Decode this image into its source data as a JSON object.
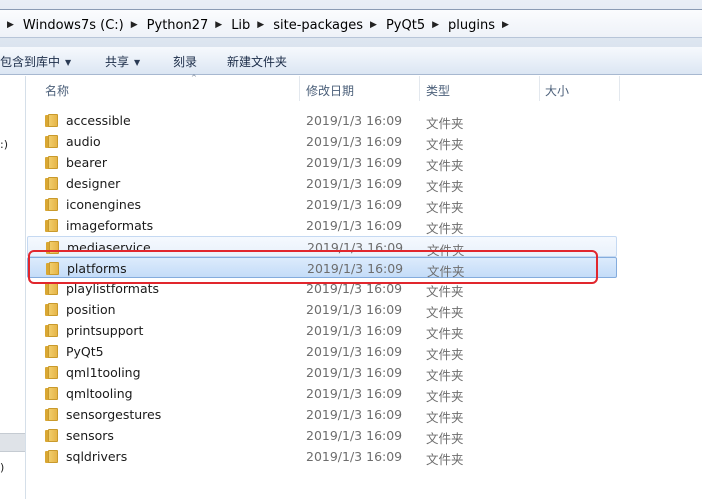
{
  "address": {
    "crumbs": [
      "Windows7s (C:)",
      "Python27",
      "Lib",
      "site-packages",
      "PyQt5",
      "plugins"
    ],
    "separator": "▶"
  },
  "toolbar": {
    "include_library": "包含到库中",
    "share": "共享",
    "burn": "刻录",
    "new_folder": "新建文件夹",
    "dropdown_arrow": "▼"
  },
  "navpane": {
    "frag1": ":)",
    "frag2": ")"
  },
  "columns": {
    "name": "名称",
    "date": "修改日期",
    "type": "类型",
    "size": "大小",
    "sort_indicator": "^"
  },
  "files": [
    {
      "name": "accessible",
      "date": "2019/1/3 16:09",
      "type": "文件夹"
    },
    {
      "name": "audio",
      "date": "2019/1/3 16:09",
      "type": "文件夹"
    },
    {
      "name": "bearer",
      "date": "2019/1/3 16:09",
      "type": "文件夹"
    },
    {
      "name": "designer",
      "date": "2019/1/3 16:09",
      "type": "文件夹"
    },
    {
      "name": "iconengines",
      "date": "2019/1/3 16:09",
      "type": "文件夹"
    },
    {
      "name": "imageformats",
      "date": "2019/1/3 16:09",
      "type": "文件夹"
    },
    {
      "name": "mediaservice",
      "date": "2019/1/3 16:09",
      "type": "文件夹"
    },
    {
      "name": "platforms",
      "date": "2019/1/3 16:09",
      "type": "文件夹"
    },
    {
      "name": "playlistformats",
      "date": "2019/1/3 16:09",
      "type": "文件夹"
    },
    {
      "name": "position",
      "date": "2019/1/3 16:09",
      "type": "文件夹"
    },
    {
      "name": "printsupport",
      "date": "2019/1/3 16:09",
      "type": "文件夹"
    },
    {
      "name": "PyQt5",
      "date": "2019/1/3 16:09",
      "type": "文件夹"
    },
    {
      "name": "qml1tooling",
      "date": "2019/1/3 16:09",
      "type": "文件夹"
    },
    {
      "name": "qmltooling",
      "date": "2019/1/3 16:09",
      "type": "文件夹"
    },
    {
      "name": "sensorgestures",
      "date": "2019/1/3 16:09",
      "type": "文件夹"
    },
    {
      "name": "sensors",
      "date": "2019/1/3 16:09",
      "type": "文件夹"
    },
    {
      "name": "sqldrivers",
      "date": "2019/1/3 16:09",
      "type": "文件夹"
    }
  ],
  "state": {
    "selected": "platforms",
    "hovered": "mediaservice"
  },
  "colors": {
    "annotation": "#e1262d",
    "selection": "#c4dcf8",
    "folder": "#e6b548"
  }
}
